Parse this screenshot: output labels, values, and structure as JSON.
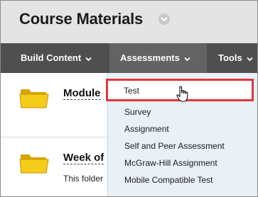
{
  "page": {
    "title": "Course Materials"
  },
  "nav": {
    "items": [
      {
        "label": "Build Content"
      },
      {
        "label": "Assessments"
      },
      {
        "label": "Tools"
      }
    ]
  },
  "content": {
    "items": [
      {
        "title": "Module",
        "description": ""
      },
      {
        "title": "Week of",
        "description": "This folder"
      }
    ]
  },
  "menu": {
    "items": [
      {
        "label": "Test"
      },
      {
        "label": "Survey"
      },
      {
        "label": "Assignment"
      },
      {
        "label": "Self and Peer Assessment"
      },
      {
        "label": "McGraw-Hill Assignment"
      },
      {
        "label": "Mobile Compatible Test"
      }
    ]
  },
  "colors": {
    "nav_bg": "#4f4f4f",
    "dropdown_bg": "#e9f0f6",
    "highlight_border": "#e0383b",
    "folder": "#f2c200"
  },
  "icons": [
    "folder-icon",
    "chevron-down-icon",
    "hand-pointer-icon"
  ]
}
